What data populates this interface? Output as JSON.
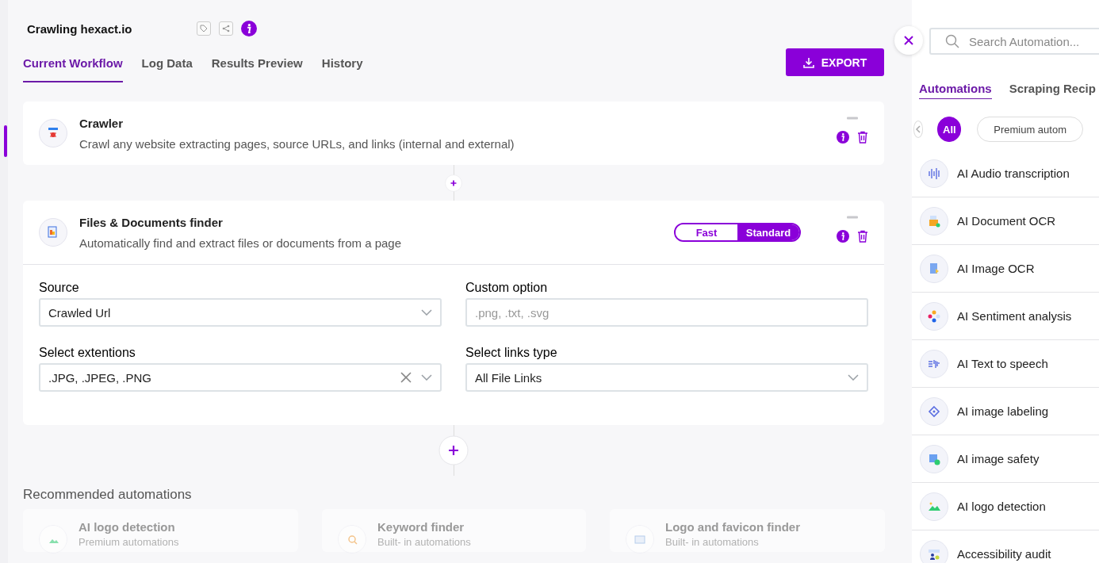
{
  "workflow": {
    "title": "Crawling hexact.io"
  },
  "tabs": [
    {
      "label": "Current Workflow",
      "selected": true
    },
    {
      "label": "Log Data",
      "selected": false
    },
    {
      "label": "Results Preview",
      "selected": false
    },
    {
      "label": "History",
      "selected": false
    }
  ],
  "export_button": {
    "label": "EXPORT"
  },
  "steps": [
    {
      "title": "Crawler",
      "description": "Crawl any website extracting pages, source URLs, and links (internal and external)"
    },
    {
      "title": "Files & Documents finder",
      "description": "Automatically find and extract files or documents from a page",
      "mode_toggle": [
        {
          "label": "Fast",
          "selected": false
        },
        {
          "label": "Standard",
          "selected": true
        }
      ],
      "fields": [
        {
          "kind": "select",
          "label": "Source",
          "value": "Crawled Url"
        },
        {
          "kind": "text",
          "label": "Custom option",
          "placeholder": ".png, .txt, .svg"
        },
        {
          "kind": "multiselect",
          "label": "Select extentions",
          "value": ".JPG, .JPEG, .PNG"
        },
        {
          "kind": "select",
          "label": "Select links type",
          "value": "All File Links"
        }
      ]
    }
  ],
  "recommended": {
    "title": "Recommended automations",
    "items": [
      {
        "title": "AI logo detection",
        "subtitle": "Premium automations"
      },
      {
        "title": "Keyword finder",
        "subtitle": "Built- in automations"
      },
      {
        "title": "Logo and favicon finder",
        "subtitle": "Built- in automations"
      }
    ]
  },
  "panel": {
    "search": {
      "placeholder": "Search Automation..."
    },
    "tabs": [
      {
        "label": "Automations",
        "selected": true
      },
      {
        "label": "Scraping Recip",
        "selected": false
      }
    ],
    "filters": [
      {
        "label": "All",
        "selected": true
      },
      {
        "label": "Premium autom",
        "selected": false
      }
    ],
    "items": [
      {
        "name": "AI Audio transcription"
      },
      {
        "name": "AI Document OCR"
      },
      {
        "name": "AI Image OCR"
      },
      {
        "name": "AI Sentiment analysis"
      },
      {
        "name": "AI Text to speech"
      },
      {
        "name": "AI image labeling"
      },
      {
        "name": "AI image safety"
      },
      {
        "name": "AI logo detection"
      },
      {
        "name": "Accessibility audit"
      }
    ]
  }
}
